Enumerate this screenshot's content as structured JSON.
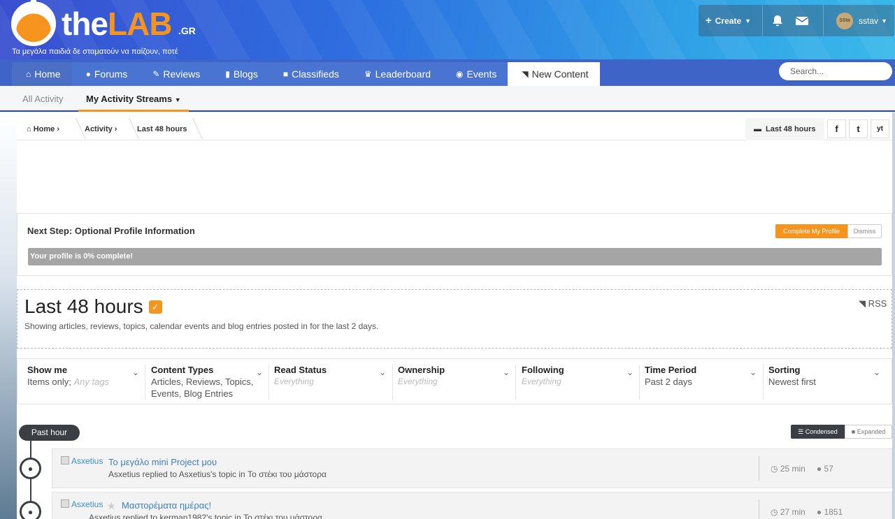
{
  "header": {
    "logo_the": "the",
    "logo_lab": "LAB",
    "logo_gr": ".GR",
    "tagline": "Τα μεγάλα παιδιά δε σταματούν να παίζουν, ποτέ",
    "create_label": "Create",
    "username": "sstav",
    "avatar_text": "SSta"
  },
  "nav": {
    "items": [
      {
        "label": "Home",
        "icon": "home-icon"
      },
      {
        "label": "Forums",
        "icon": "comments-icon"
      },
      {
        "label": "Reviews",
        "icon": "edit-icon"
      },
      {
        "label": "Blogs",
        "icon": "book-icon"
      },
      {
        "label": "Classifieds",
        "icon": "gift-icon"
      },
      {
        "label": "Leaderboard",
        "icon": "trophy-icon"
      },
      {
        "label": "Events",
        "icon": "globe-icon"
      },
      {
        "label": "New Content",
        "icon": "rss-icon"
      }
    ],
    "active": "New Content",
    "search_placeholder": "Search..."
  },
  "subnav": {
    "all_activity": "All Activity",
    "my_streams": "My Activity Streams"
  },
  "breadcrumb": {
    "items": [
      "Home",
      "Activity",
      "Last 48 hours"
    ],
    "right_label": "Last 48 hours",
    "social": [
      "f",
      "t",
      "yt"
    ]
  },
  "profile": {
    "title": "Next Step: Optional Profile Information",
    "complete_button": "Complete My Profile",
    "dismiss_button": "Dismiss",
    "progress_text": "Your profile is 0% complete!",
    "progress_fraction": 0
  },
  "stream": {
    "title": "Last 48 hours",
    "description": "Showing articles, reviews, topics, calendar events and blog entries posted in for the last 2 days.",
    "rss": "RSS"
  },
  "filters": [
    {
      "label": "Show me",
      "value": "Items only;",
      "extra": "Any tags"
    },
    {
      "label": "Content Types",
      "value": "Articles, Reviews, Topics, Events, Blog Entries"
    },
    {
      "label": "Read Status",
      "muted": "Everything"
    },
    {
      "label": "Ownership",
      "muted": "Everything"
    },
    {
      "label": "Following",
      "muted": "Everything"
    },
    {
      "label": "Time Period",
      "value": "Past 2 days"
    },
    {
      "label": "Sorting",
      "value": "Newest first"
    }
  ],
  "timeline": {
    "period_label": "Past hour",
    "condensed_label": "Condensed",
    "expanded_label": "Expanded",
    "items": [
      {
        "author": "Asxetius",
        "title": "Το μεγάλο mini Project μου",
        "subtitle": "Asxetius replied to Asxetius's topic in Το στέκι του μάστορα",
        "time": "25 min",
        "replies": "57"
      },
      {
        "author": "Asxetius",
        "title": "Μαστορέματα ημέρας!",
        "subtitle": "Asxetius replied to kerman1982's topic in Το στέκι του μάστορα",
        "time": "27 min",
        "replies": "1851"
      }
    ]
  },
  "colors": {
    "accent": "#f7941d",
    "nav_bg": "#3d64c6",
    "link": "#3d7fc8",
    "dark": "#3b3f45"
  }
}
